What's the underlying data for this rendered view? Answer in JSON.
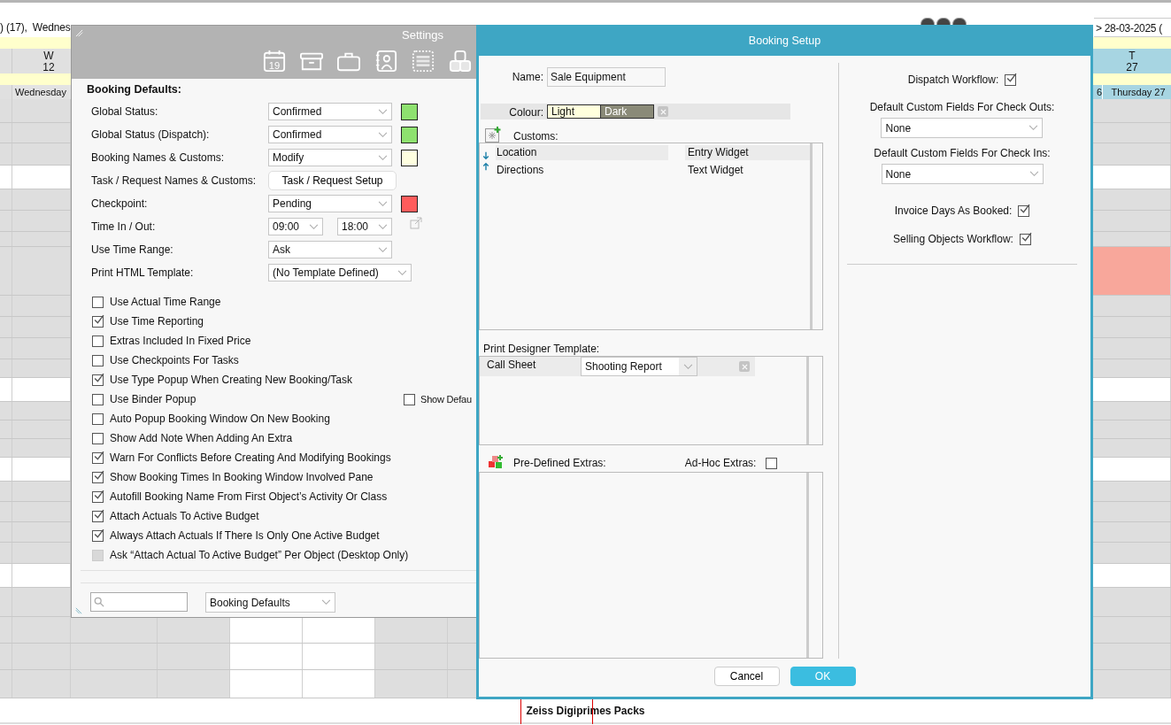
{
  "calendar": {
    "date_caption": ") (17),  Wednes",
    "range_field": "> 28-03-2025 (",
    "left_day": {
      "letter": "W",
      "number": "12",
      "name": "Wednesday"
    },
    "right_day": {
      "letter": "T",
      "number": "27",
      "name": "Thursday 27",
      "prev_fragment": "6"
    },
    "footer_label": "Zeiss Digiprimes Packs"
  },
  "settings": {
    "title": "Settings",
    "toolbar": [
      {
        "kind": "calendar",
        "text": "19",
        "selected": false
      },
      {
        "kind": "archive",
        "selected": false
      },
      {
        "kind": "briefcase",
        "selected": false
      },
      {
        "kind": "contacts",
        "selected": false
      },
      {
        "kind": "list",
        "selected": true
      },
      {
        "kind": "blocks",
        "selected": false
      }
    ],
    "section": "Booking Defaults:",
    "fields": [
      {
        "label": "Global Status:",
        "kind": "select",
        "value": "Confirmed",
        "color": "#8ee16f"
      },
      {
        "label": "Global Status (Dispatch):",
        "kind": "select",
        "value": "Confirmed",
        "color": "#8ee16f"
      },
      {
        "label": "Booking Names & Customs:",
        "kind": "select",
        "value": "Modify",
        "color": "#ffffe0"
      },
      {
        "label": "Task / Request Names & Customs:",
        "kind": "button",
        "value": "Task / Request Setup"
      },
      {
        "label": "Checkpoint:",
        "kind": "select",
        "value": "Pending",
        "color": "#ff5c5c"
      },
      {
        "label": "Time In / Out:",
        "kind": "time_range",
        "values": [
          "09:00",
          "18:00"
        ]
      },
      {
        "label": "Use Time Range:",
        "kind": "select",
        "value": "Ask"
      },
      {
        "label": "Print HTML Template:",
        "kind": "wide_select",
        "value": "(No Template Defined)"
      }
    ],
    "options": [
      {
        "label": "Use Actual Time Range",
        "checked": false,
        "disabled": false
      },
      {
        "label": "Use Time Reporting",
        "checked": true,
        "disabled": false
      },
      {
        "label": "Extras Included In Fixed Price",
        "checked": false,
        "disabled": false
      },
      {
        "label": "Use Checkpoints For Tasks",
        "checked": false,
        "disabled": false
      },
      {
        "label": "Use Type Popup When Creating New Booking/Task",
        "checked": true,
        "disabled": false
      },
      {
        "label": "Use Binder Popup",
        "checked": false,
        "disabled": false,
        "extra": {
          "label": "Show Defau",
          "checked": false
        }
      },
      {
        "label": "Auto Popup Booking Window On New Booking",
        "checked": false,
        "disabled": false
      },
      {
        "label": "Show Add Note When Adding An Extra",
        "checked": false,
        "disabled": false
      },
      {
        "label": "Warn For Conflicts Before Creating And Modifying Bookings",
        "checked": true,
        "disabled": false
      },
      {
        "label": "Show Booking Times In Booking Window Involved Pane",
        "checked": true,
        "disabled": false
      },
      {
        "label": "Autofill Booking Name From First Object’s Activity Or Class",
        "checked": true,
        "disabled": false
      },
      {
        "label": "Attach Actuals To Active Budget",
        "checked": true,
        "disabled": false
      },
      {
        "label": "Always Attach Actuals If There Is Only One Active Budget",
        "checked": true,
        "disabled": false
      },
      {
        "label": "Ask “Attach Actual To Active Budget” Per Object (Desktop Only)",
        "checked": false,
        "disabled": true
      }
    ],
    "section_select": "Booking Defaults"
  },
  "booking_setup": {
    "title": "Booking Setup",
    "name": {
      "label": "Name:",
      "value": "Sale Equipment"
    },
    "colour": {
      "label": "Colour:",
      "light": "Light",
      "dark": "Dark"
    },
    "customs": {
      "label": "Customs:",
      "rows": [
        {
          "name": "Location",
          "widget": "Entry Widget",
          "selected": true
        },
        {
          "name": "Directions",
          "widget": "Text Widget",
          "selected": false
        }
      ]
    },
    "print_template": {
      "label": "Print Designer Template:",
      "rows": [
        {
          "name": "Call Sheet",
          "template": "Shooting Report"
        }
      ]
    },
    "extras": {
      "label": "Pre-Defined Extras:",
      "adhoc_label": "Ad-Hoc Extras:",
      "adhoc_checked": false
    },
    "settings": [
      {
        "kind": "check",
        "label": "Dispatch Workflow:",
        "checked": true
      },
      {
        "kind": "select",
        "label": "Default Custom Fields For Check Outs:",
        "value": "None"
      },
      {
        "kind": "select",
        "label": "Default Custom Fields For Check Ins:",
        "value": "None"
      },
      {
        "kind": "check",
        "label": "Invoice Days As Booked:",
        "checked": true
      },
      {
        "kind": "check",
        "label": "Selling Objects Workflow:",
        "checked": true
      }
    ],
    "buttons": [
      {
        "label": "Cancel",
        "kind": "secondary"
      },
      {
        "label": "OK",
        "kind": "primary"
      }
    ]
  }
}
